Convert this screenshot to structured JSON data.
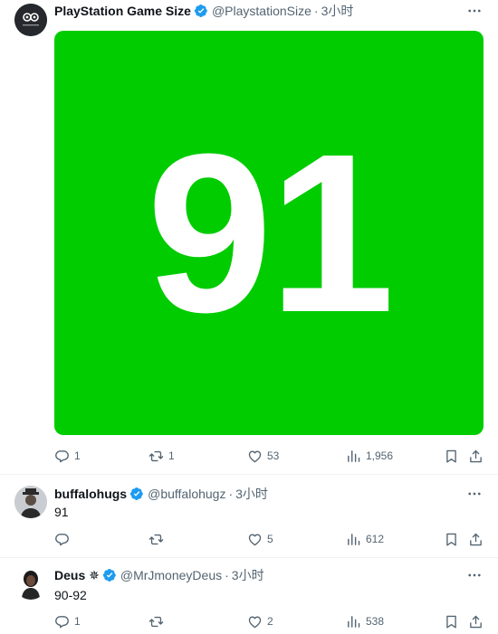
{
  "tweets": [
    {
      "name": "PlaystationGame Size",
      "display_name": "PlayStation Game Size",
      "handle": "@PlaystationSize",
      "time": "3小时",
      "media_text": "91",
      "media_color": "#00cc00",
      "replies": "1",
      "retweets": "1",
      "likes": "53",
      "views": "1,956"
    },
    {
      "display_name": "buffalohugs",
      "handle": "@buffalohugz",
      "time": "3小时",
      "text": "91",
      "replies": "",
      "retweets": "",
      "likes": "5",
      "views": "612"
    },
    {
      "display_name": "Deus ✵",
      "handle": "@MrJmoneyDeus",
      "time": "3小时",
      "text": "90-92",
      "replies": "1",
      "retweets": "",
      "likes": "2",
      "views": "538"
    }
  ],
  "colors": {
    "accent": "#1d9bf0",
    "muted": "#536471",
    "media_bg": "#00cc00"
  },
  "icons": [
    "verified-badge-icon",
    "more-icon",
    "reply-icon",
    "retweet-icon",
    "like-icon",
    "views-icon",
    "bookmark-icon",
    "share-icon"
  ]
}
